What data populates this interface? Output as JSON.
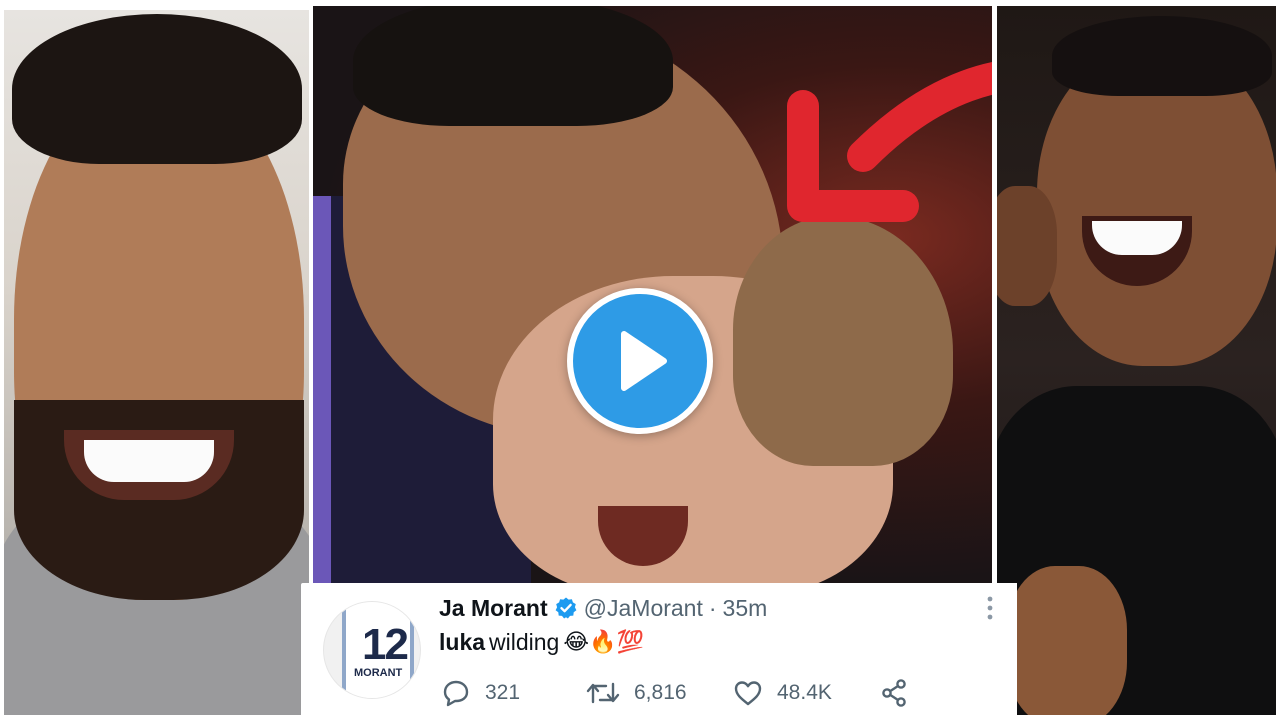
{
  "tweet": {
    "display_name": "Ja Morant",
    "handle": "@JaMorant",
    "separator": "·",
    "time": "35m",
    "text_bold": "luka",
    "text_rest": "wilding",
    "emojis": "😂🔥💯",
    "avatar": {
      "jersey_number": "12",
      "jersey_name": "MORANT"
    },
    "stats": {
      "replies": "321",
      "retweets": "6,816",
      "likes": "48.4K"
    }
  },
  "icons": {
    "verified": "verified-badge-icon",
    "more": "more-vertical-icon",
    "reply": "reply-icon",
    "retweet": "retweet-icon",
    "like": "heart-icon",
    "share": "share-icon",
    "play": "play-icon",
    "arrow": "red-arrow-icon"
  },
  "colors": {
    "play_button": "#2e9be6",
    "arrow": "#e0262e",
    "verified": "#1d9bf0",
    "secondary_text": "#536471"
  }
}
